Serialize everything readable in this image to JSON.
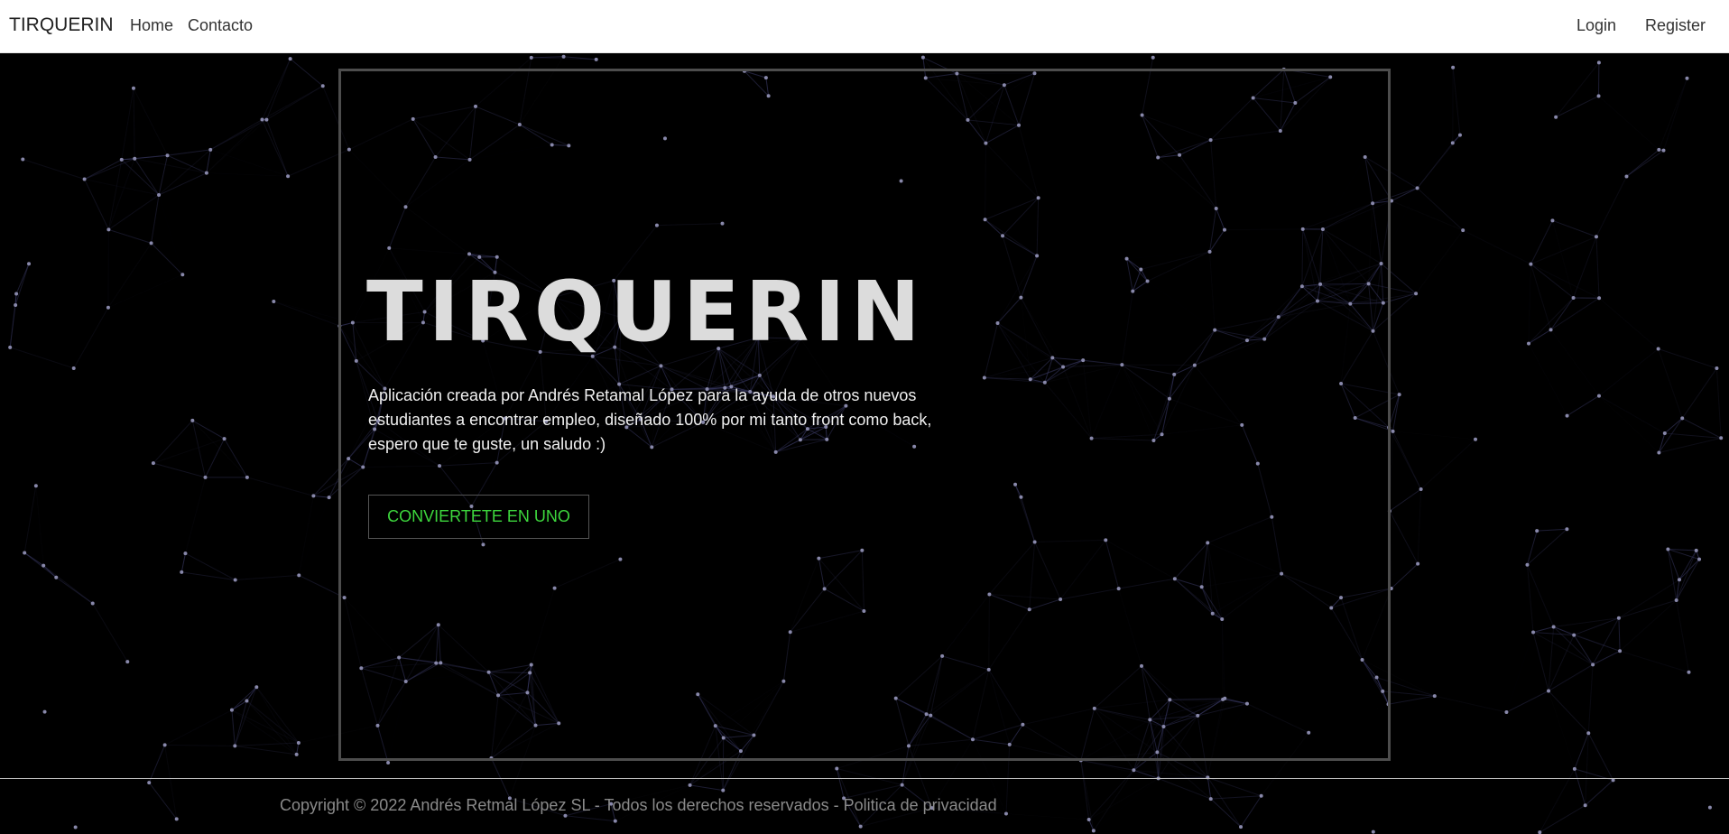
{
  "navbar": {
    "brand": "TIRQUERIN",
    "links": [
      "Home",
      "Contacto"
    ],
    "auth": {
      "login": "Login",
      "register": "Register"
    }
  },
  "hero": {
    "title": "TIRQUERIN",
    "description": "Aplicación creada por Andrés Retamal López para la ayuda de otros nuevos estudiantes a encontrar empleo, diseñado 100% por mi tanto front como back, espero que te guste, un saludo :)",
    "cta_label": "CONVIERTETE EN UNO"
  },
  "footer": {
    "copyright": "Copyright © 2022 Andrés Retmal López SL - Todos los derechos reservados - Politica de privacidad"
  },
  "colors": {
    "background": "#000000",
    "navbar": "#ffffff",
    "cta_text": "#3dd63d",
    "particles": "#8888aa"
  }
}
